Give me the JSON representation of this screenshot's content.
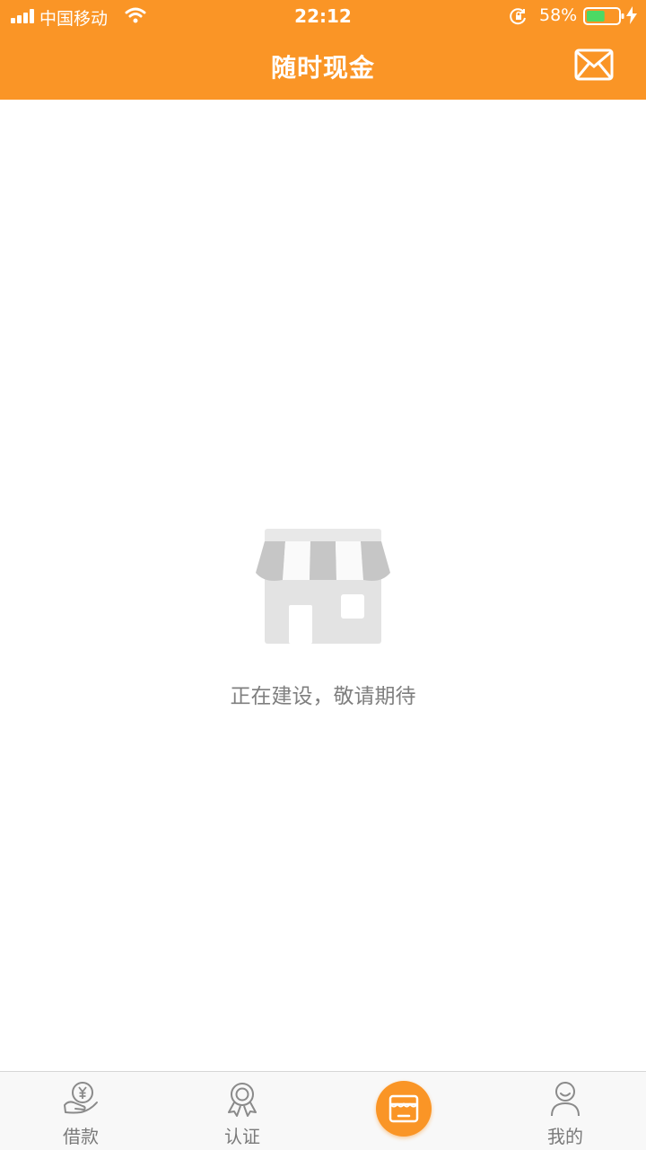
{
  "status_bar": {
    "carrier": "中国移动",
    "time": "22:12",
    "battery_percent": "58%",
    "battery_level": 0.58
  },
  "header": {
    "title": "随时现金"
  },
  "placeholder": {
    "message": "正在建设，敬请期待"
  },
  "tabbar": {
    "tabs": [
      {
        "label": "借款",
        "icon": "loan-icon"
      },
      {
        "label": "认证",
        "icon": "certification-icon"
      },
      {
        "label": "",
        "icon": "store-icon"
      },
      {
        "label": "我的",
        "icon": "profile-icon"
      }
    ]
  },
  "colors": {
    "brand_orange": "#FA9526",
    "tab_gray": "#7a7a7a",
    "illustration_gray": "#e3e3e3"
  }
}
